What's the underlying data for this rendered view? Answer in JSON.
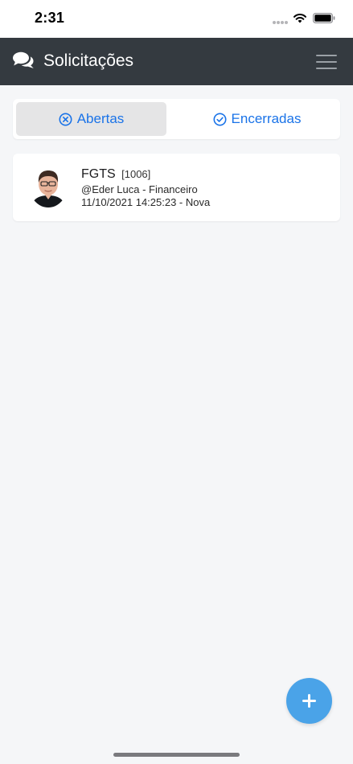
{
  "status_bar": {
    "time": "2:31",
    "icons": [
      "signal-dots-icon",
      "wifi-icon",
      "battery-icon"
    ]
  },
  "header": {
    "title": "Solicitações",
    "icon": "chat-bubbles-icon",
    "menu_icon": "hamburger-menu-icon",
    "background_color": "#343a40"
  },
  "tabs": [
    {
      "label": "Abertas",
      "icon": "x-circle-icon",
      "selected": true
    },
    {
      "label": "Encerradas",
      "icon": "check-circle-icon",
      "selected": false
    }
  ],
  "requests": [
    {
      "title": "FGTS",
      "code": "[1006]",
      "user_line": "@Eder Luca - Financeiro",
      "date_line": "11/10/2021 14:25:23 - Nova",
      "avatar": "user-avatar-photo"
    }
  ],
  "fab": {
    "icon": "plus-icon",
    "color": "#4aa3e8"
  },
  "colors": {
    "accent": "#1a73e8",
    "page_background": "#f5f6f8",
    "selected_tab": "#e5e5e6"
  }
}
